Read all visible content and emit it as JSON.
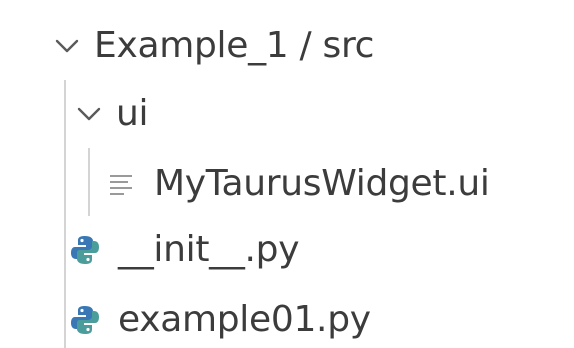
{
  "explorer": {
    "root": {
      "label": "Example_1 / src",
      "expanded": true,
      "icon": "chevron-down-icon"
    },
    "items": [
      {
        "label": "ui",
        "type": "folder",
        "expanded": true,
        "icon": "chevron-down-icon"
      },
      {
        "label": "MyTaurusWidget.ui",
        "type": "file",
        "icon": "lines-file-icon"
      },
      {
        "label": "__init__.py",
        "type": "file",
        "icon": "python-icon"
      },
      {
        "label": "example01.py",
        "type": "file",
        "icon": "python-icon"
      }
    ]
  },
  "colors": {
    "text": "#3c3c3c",
    "chevron": "#5a5a5a",
    "guide": "#d4d4d4",
    "python_blue": "#3a78b5",
    "python_teal": "#4a9d9b"
  }
}
